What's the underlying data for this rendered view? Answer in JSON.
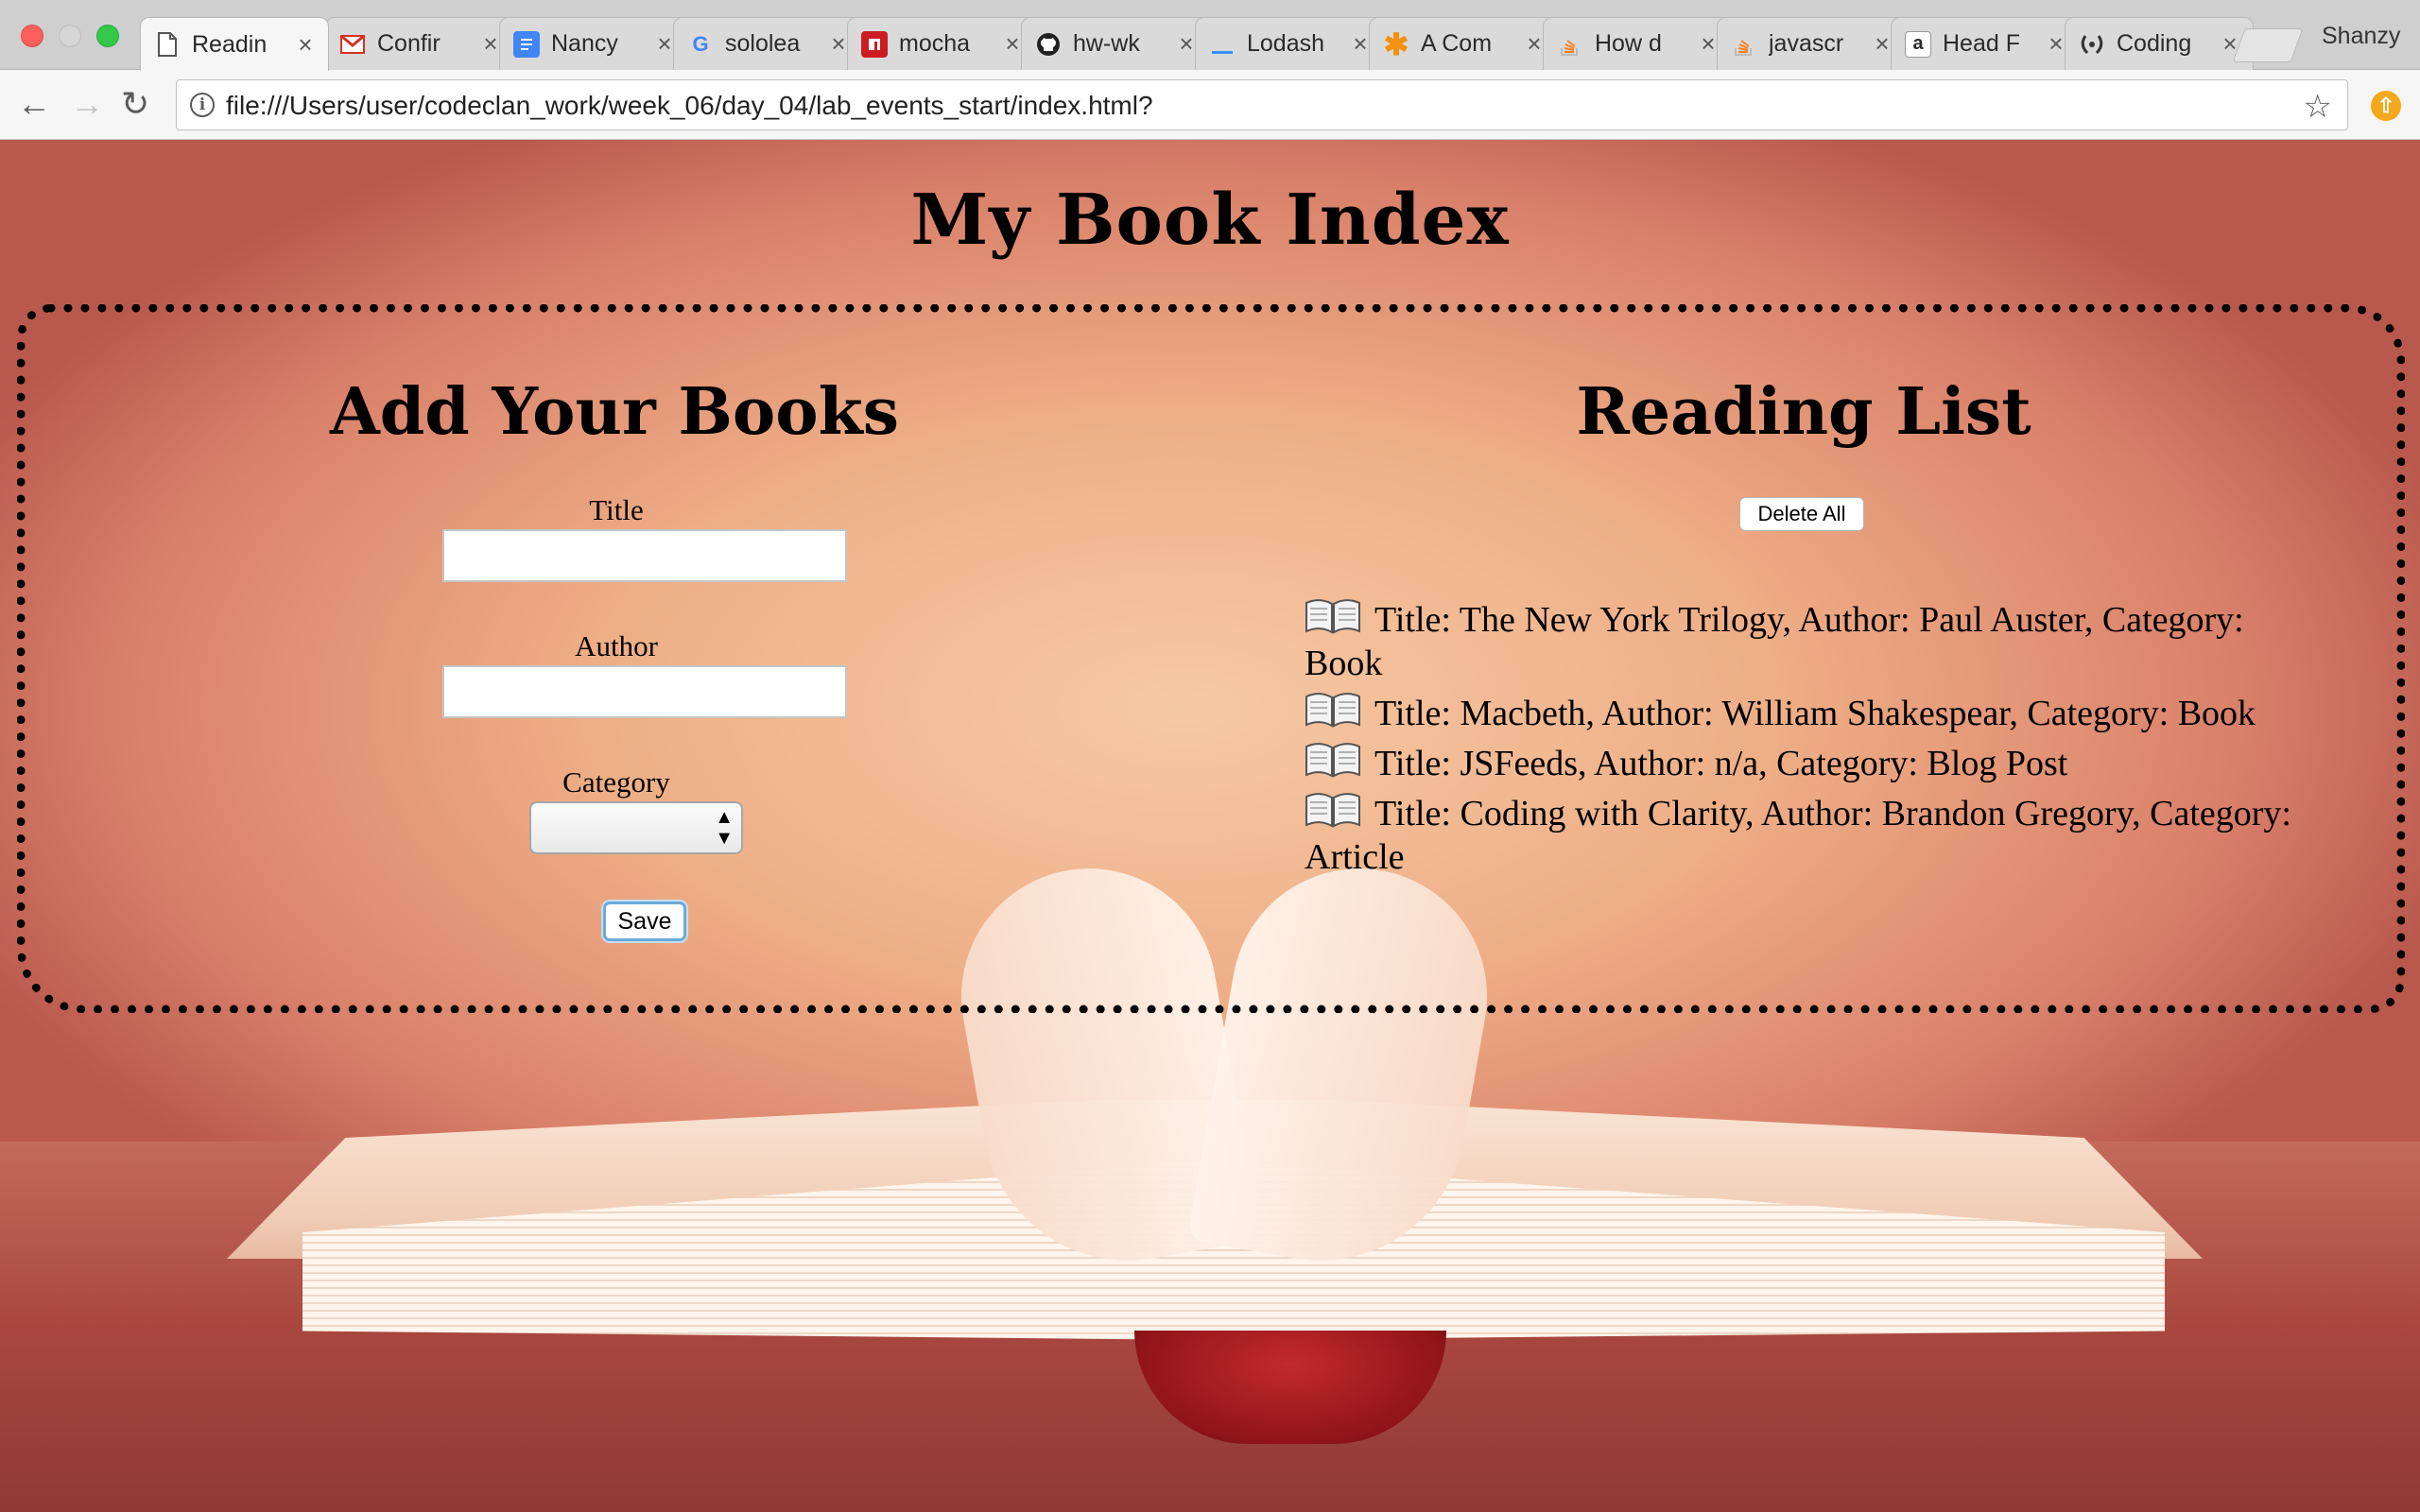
{
  "browser": {
    "tabs": [
      {
        "label": "Readin",
        "favicon": "document-icon",
        "active": true
      },
      {
        "label": "Confir",
        "favicon": "gmail-icon",
        "active": false
      },
      {
        "label": "Nancy",
        "favicon": "google-docs-icon",
        "active": false
      },
      {
        "label": "sololea",
        "favicon": "google-icon",
        "active": false
      },
      {
        "label": "mocha",
        "favicon": "npm-icon",
        "active": false
      },
      {
        "label": "hw-wk",
        "favicon": "github-icon",
        "active": false
      },
      {
        "label": "Lodash",
        "favicon": "lodash-icon",
        "active": false
      },
      {
        "label": "A Com",
        "favicon": "asterisk-icon",
        "active": false
      },
      {
        "label": "How d",
        "favicon": "stackoverflow-icon",
        "active": false
      },
      {
        "label": "javascr",
        "favicon": "stackoverflow-icon",
        "active": false
      },
      {
        "label": "Head F",
        "favicon": "amazon-icon",
        "active": false
      },
      {
        "label": "Coding",
        "favicon": "laurel-icon",
        "active": false
      }
    ],
    "tab_close_glyph": "×",
    "profile_name": "Shanzy",
    "url": "file:///Users/user/codeclan_work/week_06/day_04/lab_events_start/index.html?"
  },
  "page": {
    "title": "My Book Index",
    "form": {
      "heading": "Add Your Books",
      "title_label": "Title",
      "title_value": "",
      "author_label": "Author",
      "author_value": "",
      "category_label": "Category",
      "category_value": "",
      "save_label": "Save"
    },
    "list": {
      "heading": "Reading List",
      "delete_all_label": "Delete All",
      "items": [
        {
          "text": "Title: The New York Trilogy, Author: Paul Auster, Category: Book",
          "icon": "open-book-icon"
        },
        {
          "text": "Title: Macbeth, Author: William Shakespear, Category: Book",
          "icon": "open-book-icon"
        },
        {
          "text": "Title: JSFeeds, Author: n/a, Category: Blog Post",
          "icon": "open-book-icon"
        },
        {
          "text": "Title: Coding with Clarity, Author: Brandon Gregory, Category: Article",
          "icon": "open-book-icon"
        }
      ]
    }
  },
  "colors": {
    "save_focus_ring": "#6ea9d9",
    "traffic_red": "#fc605c",
    "traffic_green": "#34c84a",
    "tab_active": "#f6f6f6",
    "tab_inactive": "#dadada"
  }
}
